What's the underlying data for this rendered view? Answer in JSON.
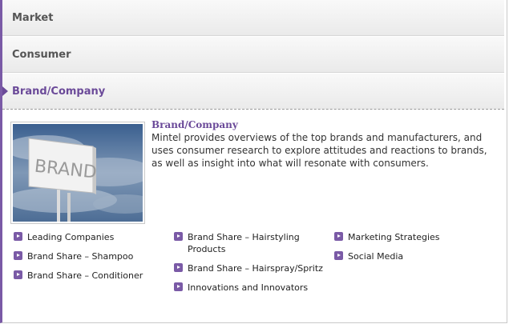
{
  "tabs": {
    "market": "Market",
    "consumer": "Consumer",
    "brand": "Brand/Company"
  },
  "panel": {
    "image_icon": "brand-billboard-image",
    "title": "Brand/Company",
    "description": "Mintel provides overviews of the top brands and manufacturers, and uses consumer research to explore attitudes and reactions to brands, as well as insight into what will resonate with consumers."
  },
  "links": {
    "col1": [
      "Leading Companies",
      "Brand Share – Shampoo",
      "Brand Share – Conditioner"
    ],
    "col2": [
      "Brand Share – Hairstyling Products",
      "Brand Share – Hairspray/Spritz",
      "Innovations and Innovators"
    ],
    "col3": [
      "Marketing Strategies",
      "Social Media"
    ]
  },
  "colors": {
    "accent": "#6b4a99",
    "frame": "#7a5aa6"
  }
}
